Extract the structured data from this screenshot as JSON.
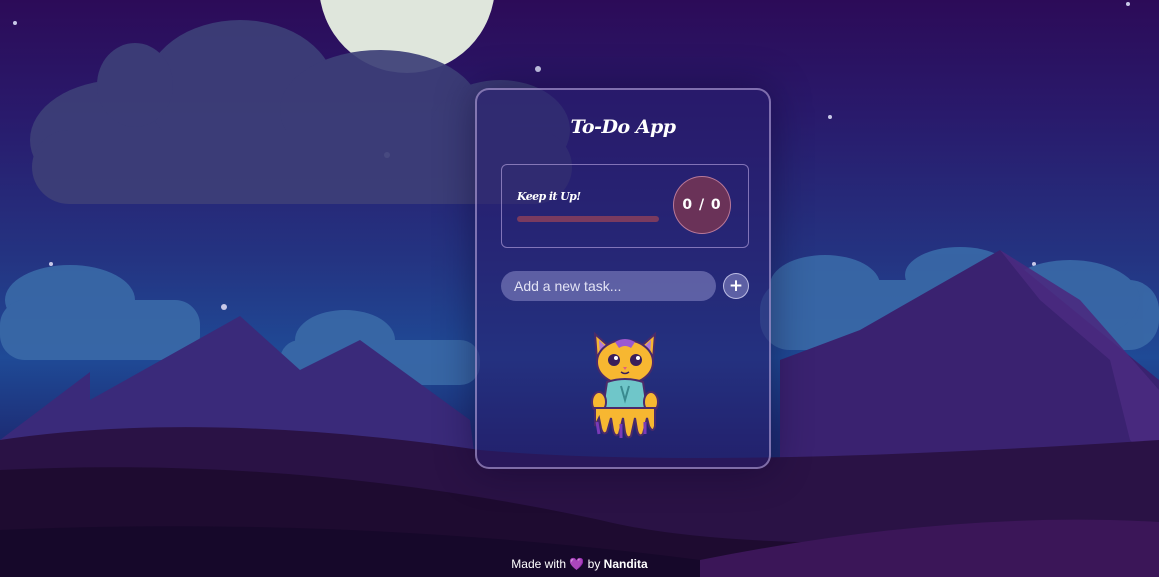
{
  "app": {
    "title": "To-Do App"
  },
  "progress": {
    "label": "Keep it Up!",
    "completed": 0,
    "total": 0,
    "fraction": 0,
    "count_text": "0 / 0"
  },
  "task_input": {
    "value": "",
    "placeholder": "Add a new task..."
  },
  "add_button": {
    "label": "+"
  },
  "footer": {
    "made_with": "Made with",
    "heart": "💜",
    "by": "by",
    "author": "Nandita"
  },
  "colors": {
    "accent": "#e94b8a",
    "progress_track": "#7a3a5f",
    "circle_bg": "#6a3258",
    "heart": "#8a4fe0"
  },
  "icons": {
    "add": "plus-icon",
    "mascot": "cat-mascot-illustration"
  }
}
